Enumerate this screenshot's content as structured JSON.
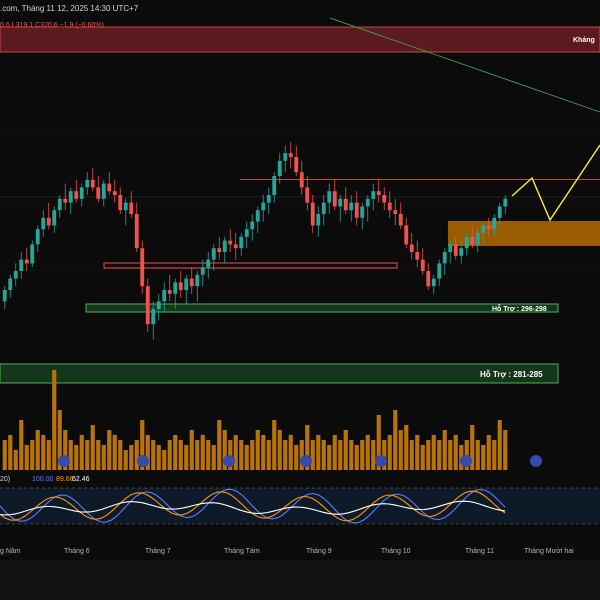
{
  "header": {
    "title": ".com, Tháng 11 12, 2025 14:30 UTC+7",
    "ohlc_text": "0.6  L319.1  C320.6  −1.9 (−0.60%)"
  },
  "zones": {
    "resistance_label": "Kháng",
    "support1_label": "Hỗ Trợ : 296-298",
    "support2_label": "Hỗ Trợ : 281-285"
  },
  "indicator": {
    "label_prefix": "20)",
    "values": [
      "100.00",
      "89.66",
      "62.46"
    ],
    "value_colors": [
      "#5b7cff",
      "#ff9800",
      "#ffffff"
    ]
  },
  "xaxis": {
    "labels": [
      "g Năm",
      "Tháng 6",
      "Tháng 7",
      "Tháng Tám",
      "Tháng 9",
      "Tháng 10",
      "Tháng 11",
      "Tháng Mười hai"
    ]
  },
  "colors": {
    "up": "#26a69a",
    "down": "#ef5350",
    "resistance_zone": "#5a1a20",
    "support_zone": "#4caf50",
    "orange_zone": "#b36b00",
    "projection": "#ffeb3b",
    "trendline": "#4caf50",
    "volume": "#b8730a"
  },
  "chart_data": {
    "type": "candlestick",
    "x_labels": [
      "g Năm",
      "Tháng 6",
      "Tháng 7",
      "Tháng Tám",
      "Tháng 9",
      "Tháng 10",
      "Tháng 11",
      "Tháng Mười hai"
    ],
    "price_range": [
      270,
      345
    ],
    "candles": [
      [
        292,
        296,
        290,
        295
      ],
      [
        295,
        299,
        293,
        298
      ],
      [
        298,
        302,
        296,
        300
      ],
      [
        300,
        305,
        298,
        303
      ],
      [
        303,
        306,
        300,
        302
      ],
      [
        302,
        308,
        301,
        307
      ],
      [
        307,
        312,
        305,
        311
      ],
      [
        311,
        316,
        309,
        314
      ],
      [
        314,
        318,
        311,
        312
      ],
      [
        312,
        317,
        310,
        316
      ],
      [
        316,
        320,
        314,
        319
      ],
      [
        319,
        323,
        316,
        318
      ],
      [
        318,
        322,
        315,
        321
      ],
      [
        321,
        324,
        318,
        319
      ],
      [
        319,
        323,
        317,
        322
      ],
      [
        322,
        326,
        320,
        324
      ],
      [
        324,
        327,
        321,
        322
      ],
      [
        322,
        325,
        318,
        319
      ],
      [
        319,
        324,
        317,
        323
      ],
      [
        323,
        326,
        320,
        321
      ],
      [
        321,
        324,
        318,
        320
      ],
      [
        320,
        322,
        315,
        316
      ],
      [
        316,
        319,
        312,
        318
      ],
      [
        318,
        321,
        314,
        315
      ],
      [
        315,
        318,
        305,
        306
      ],
      [
        306,
        308,
        294,
        296
      ],
      [
        296,
        298,
        284,
        286
      ],
      [
        286,
        292,
        282,
        290
      ],
      [
        290,
        294,
        287,
        292
      ],
      [
        292,
        297,
        289,
        295
      ],
      [
        295,
        299,
        292,
        294
      ],
      [
        294,
        298,
        290,
        297
      ],
      [
        297,
        300,
        293,
        295
      ],
      [
        295,
        299,
        291,
        298
      ],
      [
        298,
        301,
        294,
        296
      ],
      [
        296,
        300,
        292,
        299
      ],
      [
        299,
        303,
        296,
        301
      ],
      [
        301,
        305,
        298,
        303
      ],
      [
        303,
        307,
        300,
        306
      ],
      [
        306,
        309,
        303,
        305
      ],
      [
        305,
        309,
        302,
        308
      ],
      [
        308,
        311,
        305,
        307
      ],
      [
        307,
        310,
        303,
        306
      ],
      [
        306,
        310,
        304,
        309
      ],
      [
        309,
        313,
        306,
        311
      ],
      [
        311,
        315,
        308,
        313
      ],
      [
        313,
        317,
        310,
        316
      ],
      [
        316,
        320,
        313,
        318
      ],
      [
        318,
        322,
        315,
        320
      ],
      [
        320,
        326,
        318,
        325
      ],
      [
        325,
        331,
        323,
        329
      ],
      [
        329,
        333,
        326,
        331
      ],
      [
        331,
        334,
        327,
        330
      ],
      [
        330,
        333,
        325,
        326
      ],
      [
        326,
        329,
        320,
        322
      ],
      [
        322,
        325,
        316,
        318
      ],
      [
        318,
        320,
        310,
        312
      ],
      [
        312,
        317,
        309,
        315
      ],
      [
        315,
        320,
        312,
        318
      ],
      [
        318,
        323,
        315,
        321
      ],
      [
        321,
        324,
        316,
        317
      ],
      [
        317,
        320,
        313,
        319
      ],
      [
        319,
        322,
        315,
        316
      ],
      [
        316,
        320,
        313,
        318
      ],
      [
        318,
        321,
        312,
        314
      ],
      [
        314,
        318,
        311,
        317
      ],
      [
        317,
        320,
        313,
        319
      ],
      [
        319,
        323,
        316,
        321
      ],
      [
        321,
        324,
        318,
        320
      ],
      [
        320,
        322,
        316,
        318
      ],
      [
        318,
        321,
        314,
        316
      ],
      [
        316,
        319,
        312,
        315
      ],
      [
        315,
        318,
        311,
        312
      ],
      [
        312,
        314,
        306,
        307
      ],
      [
        307,
        310,
        303,
        305
      ],
      [
        305,
        308,
        301,
        303
      ],
      [
        303,
        306,
        299,
        300
      ],
      [
        300,
        302,
        295,
        296
      ],
      [
        296,
        299,
        294,
        298
      ],
      [
        298,
        303,
        296,
        302
      ],
      [
        302,
        306,
        299,
        305
      ],
      [
        305,
        308,
        302,
        307
      ],
      [
        307,
        309,
        303,
        304
      ],
      [
        304,
        308,
        302,
        306
      ],
      [
        306,
        310,
        304,
        309
      ],
      [
        309,
        312,
        306,
        307
      ],
      [
        307,
        311,
        305,
        310
      ],
      [
        310,
        313,
        307,
        312
      ],
      [
        312,
        314,
        309,
        311
      ],
      [
        311,
        315,
        309,
        314
      ],
      [
        314,
        318,
        312,
        317
      ],
      [
        317,
        320,
        315,
        319
      ]
    ],
    "volume": [
      0.3,
      0.35,
      0.2,
      0.5,
      0.25,
      0.3,
      0.4,
      0.35,
      0.3,
      1.0,
      0.6,
      0.4,
      0.3,
      0.25,
      0.35,
      0.3,
      0.45,
      0.3,
      0.25,
      0.4,
      0.35,
      0.3,
      0.2,
      0.25,
      0.3,
      0.5,
      0.35,
      0.3,
      0.25,
      0.2,
      0.3,
      0.35,
      0.3,
      0.25,
      0.4,
      0.3,
      0.35,
      0.3,
      0.25,
      0.5,
      0.4,
      0.3,
      0.35,
      0.3,
      0.25,
      0.3,
      0.4,
      0.35,
      0.3,
      0.5,
      0.4,
      0.3,
      0.35,
      0.25,
      0.3,
      0.45,
      0.3,
      0.35,
      0.3,
      0.25,
      0.35,
      0.3,
      0.4,
      0.3,
      0.25,
      0.3,
      0.35,
      0.3,
      0.55,
      0.3,
      0.35,
      0.6,
      0.4,
      0.45,
      0.3,
      0.35,
      0.25,
      0.3,
      0.35,
      0.3,
      0.4,
      0.3,
      0.35,
      0.25,
      0.3,
      0.45,
      0.3,
      0.25,
      0.35,
      0.3,
      0.5,
      0.4
    ],
    "zones": [
      {
        "name": "Kháng",
        "from": 339,
        "to": 344
      },
      {
        "name": "Hỗ Trợ : 296-298",
        "from": 296,
        "to": 298
      },
      {
        "name": "Hỗ Trợ : 281-285",
        "from": 281,
        "to": 285
      }
    ],
    "indicator_values": [
      100.0,
      89.66,
      62.46
    ]
  }
}
